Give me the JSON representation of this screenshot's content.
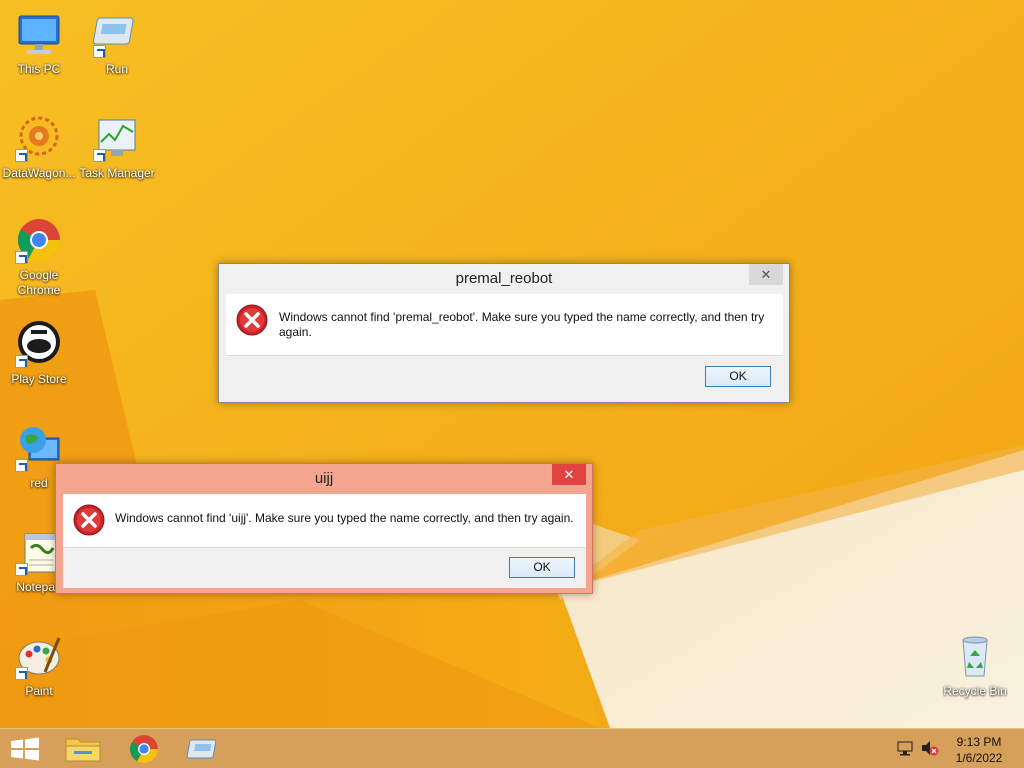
{
  "desktop": {
    "icons": [
      {
        "id": "this-pc",
        "label": "This PC"
      },
      {
        "id": "run",
        "label": "Run"
      },
      {
        "id": "datawagon",
        "label": "DataWagon..."
      },
      {
        "id": "task-manager",
        "label": "Task Manager"
      },
      {
        "id": "google-chrome",
        "label": "Google\nChrome"
      },
      {
        "id": "play-store",
        "label": "Play Store"
      },
      {
        "id": "red",
        "label": "red"
      },
      {
        "id": "notepad",
        "label": "Notepad"
      },
      {
        "id": "paint",
        "label": "Paint"
      },
      {
        "id": "recycle-bin",
        "label": "Recycle Bin"
      }
    ]
  },
  "dialogs": [
    {
      "title": "premal_reobot",
      "close_glyph": "✕",
      "message": "Windows cannot find 'premal_reobot'. Make sure you typed the name correctly, and then try again.",
      "ok_label": "OK",
      "active": false
    },
    {
      "title": "uijj",
      "close_glyph": "✕",
      "message": "Windows cannot find 'uijj'. Make sure you typed the name correctly, and then try again.",
      "ok_label": "OK",
      "active": true
    }
  ],
  "taskbar": {
    "items": [
      "start-button",
      "file-explorer",
      "google-chrome",
      "run"
    ],
    "clock": {
      "time": "9:13 PM",
      "date": "1/6/2022"
    }
  },
  "colors": {
    "wallpaper": "#f4ad12",
    "active_frame": "#f3a590",
    "inactive_frame": "#f0f0f0",
    "close_active": "#e04343",
    "taskbar": "#d6a05a"
  }
}
